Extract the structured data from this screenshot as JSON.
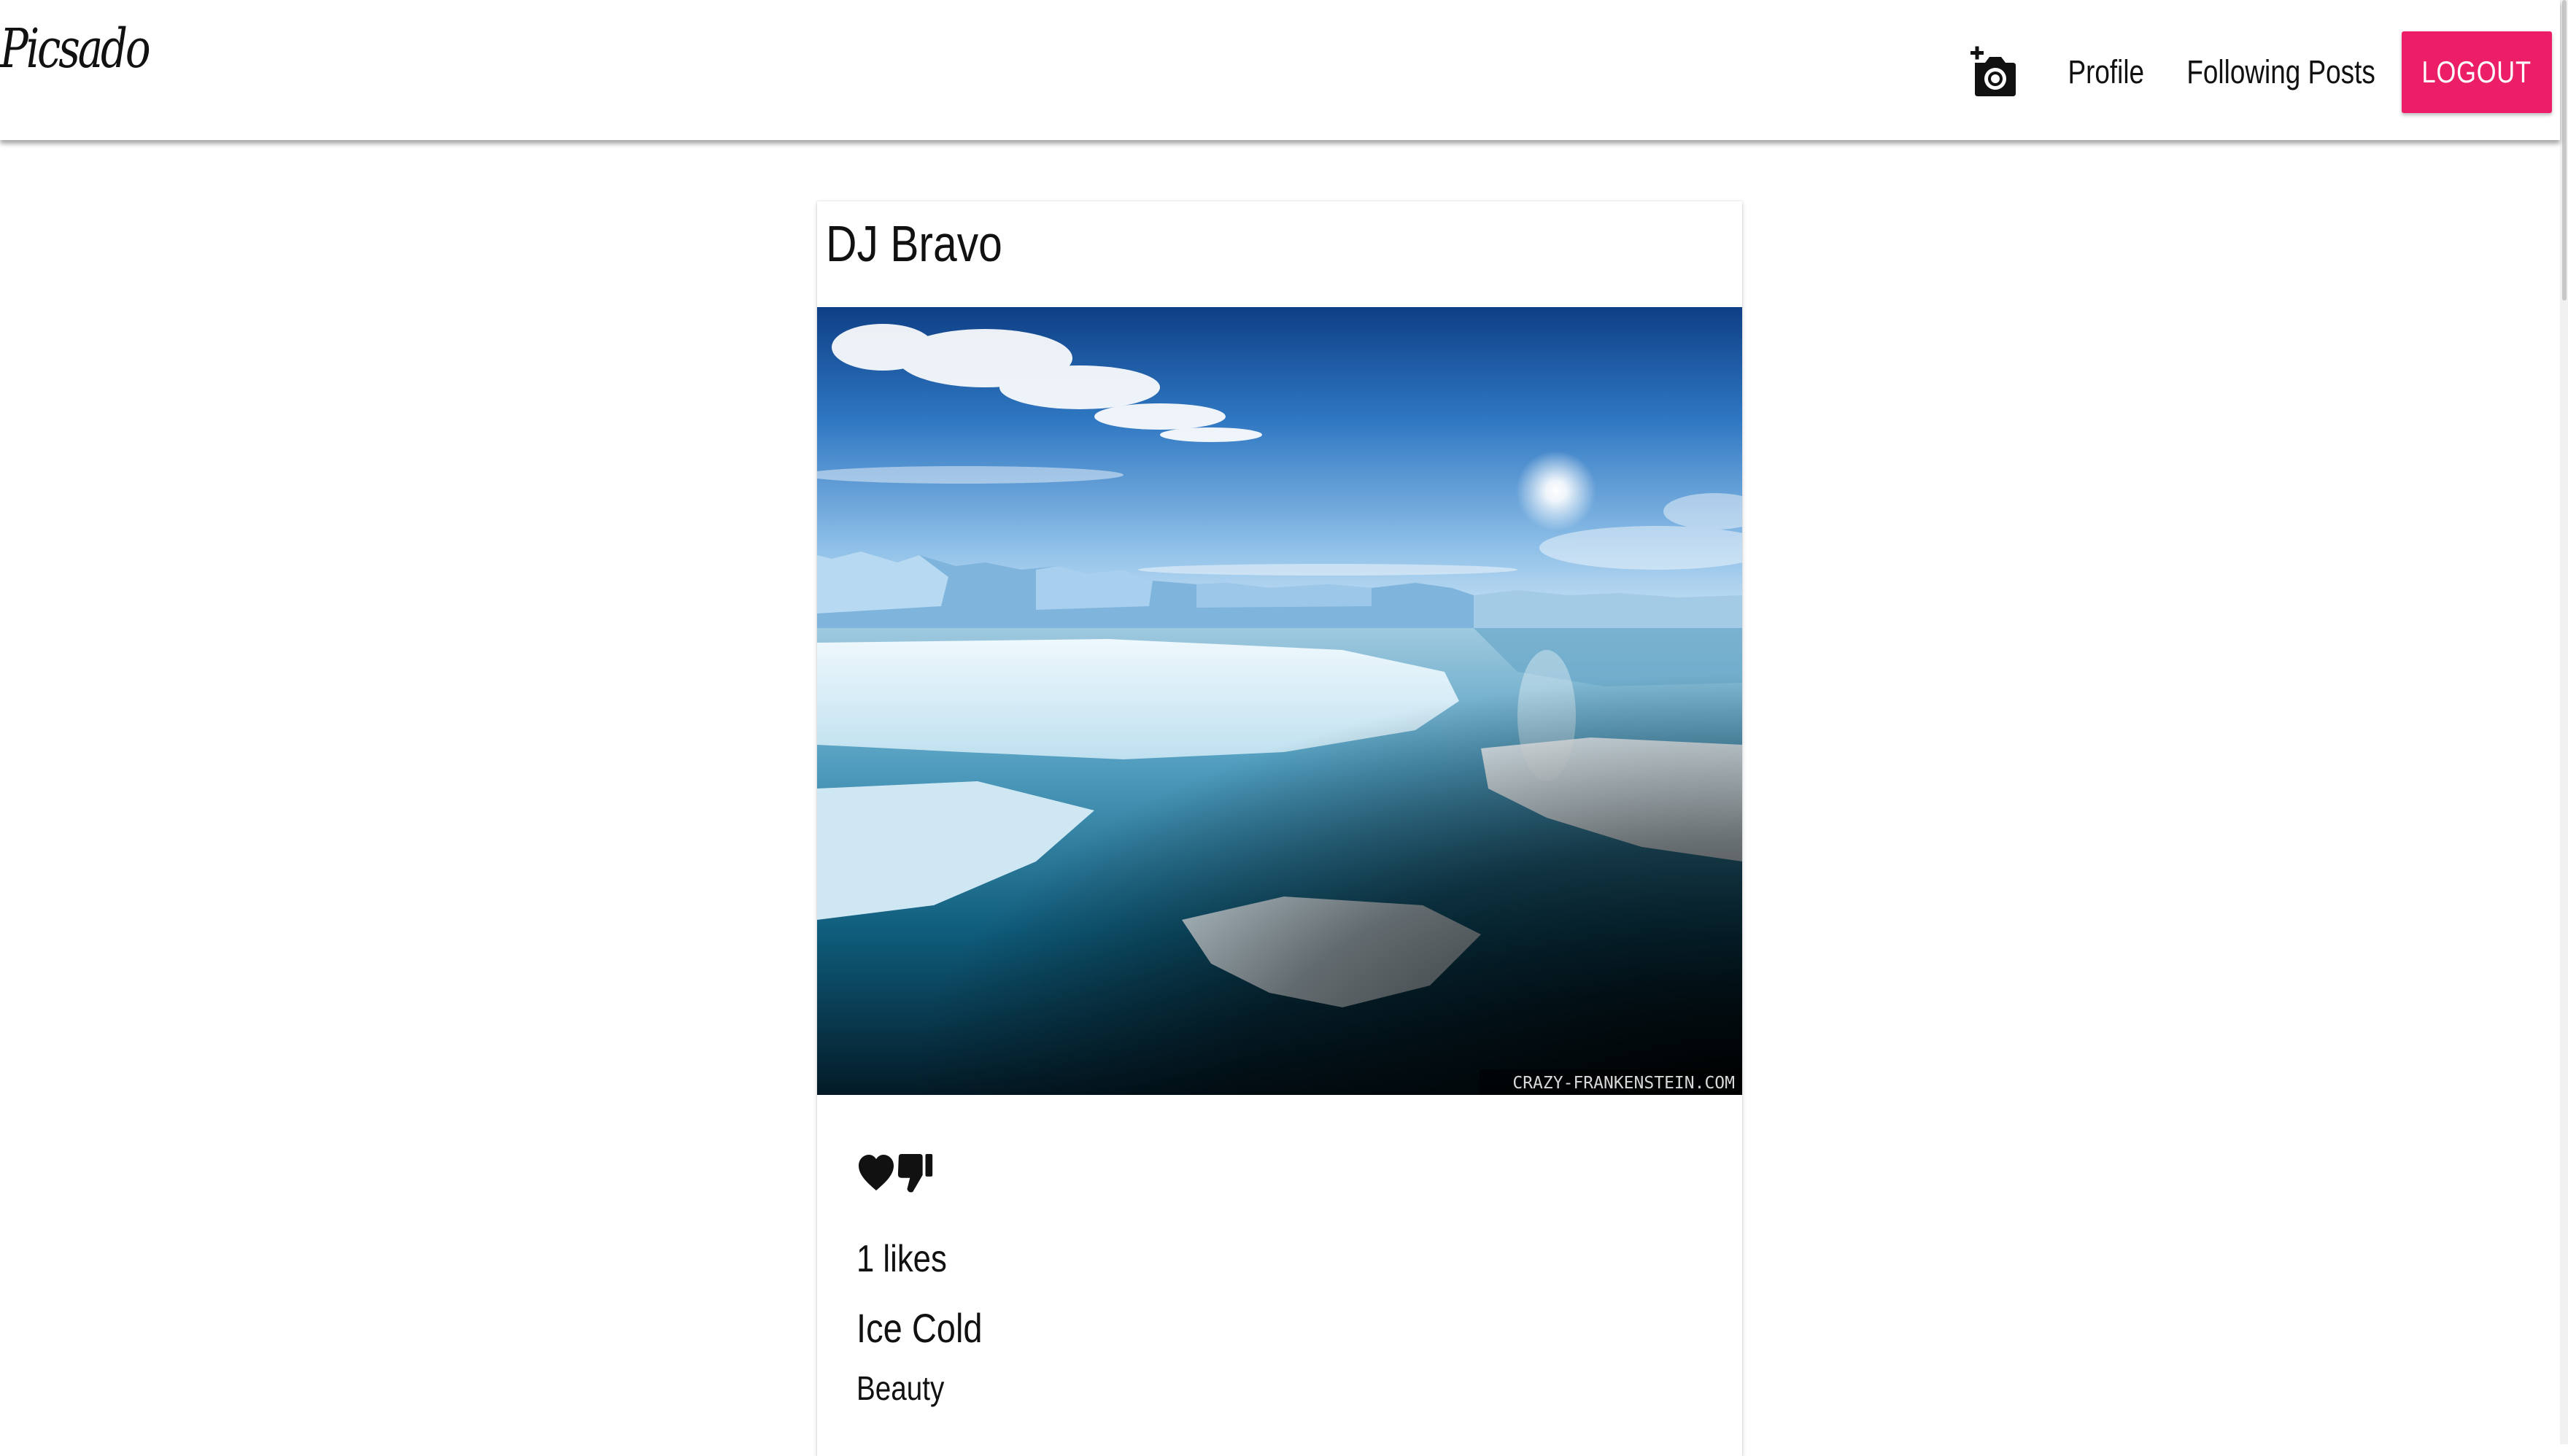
{
  "navbar": {
    "brand": "Picsado",
    "links": {
      "profile": "Profile",
      "following": "Following Posts"
    },
    "logout_label": "LOGOUT",
    "accent_color": "#ed1e68",
    "create_icon": "add-photo-camera-icon"
  },
  "post": {
    "author": "DJ Bravo",
    "image_watermark": "CRAZY-FRANKENSTEIN.COM",
    "actions": {
      "like_icon": "heart-icon",
      "dislike_icon": "thumbs-down-icon"
    },
    "likes_text": "1 likes",
    "title": "Ice Cold",
    "caption": "Beauty"
  }
}
